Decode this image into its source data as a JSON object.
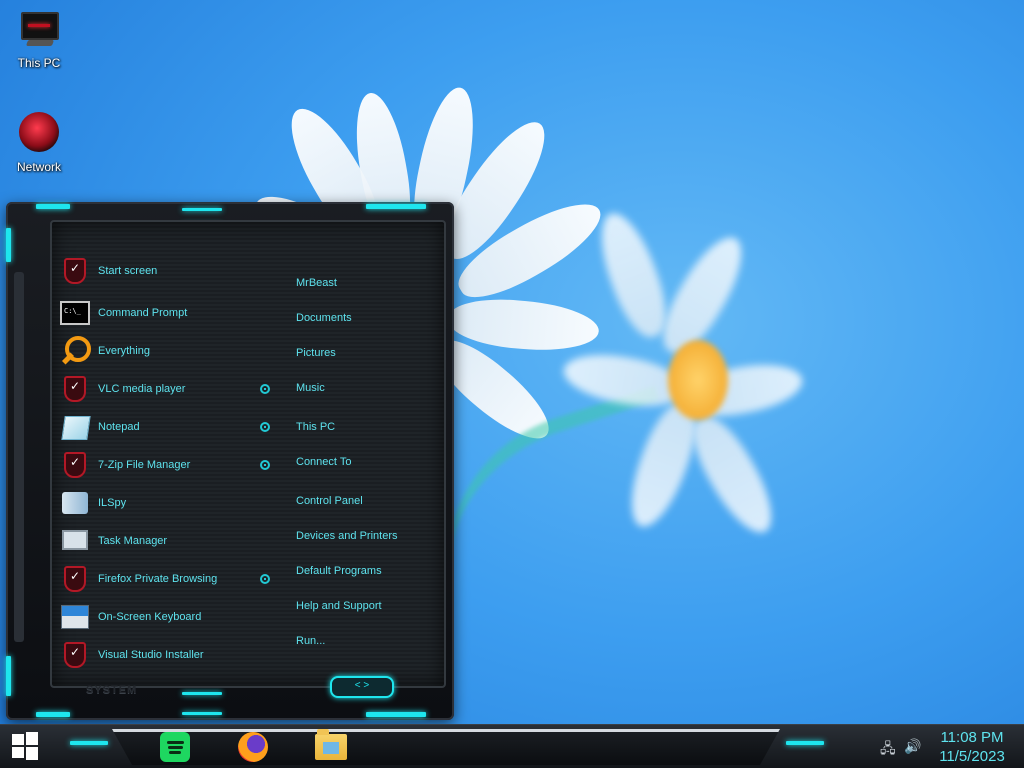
{
  "desktop": {
    "icons": [
      {
        "label": "This PC",
        "icon": "monitor-icon"
      },
      {
        "label": "Network",
        "icon": "network-orb-icon"
      }
    ]
  },
  "start_menu": {
    "programs": [
      {
        "label": "Start screen",
        "icon": "shield-app-icon"
      },
      {
        "label": "Command Prompt",
        "icon": "command-prompt-icon"
      },
      {
        "label": "Everything",
        "icon": "magnifier-icon"
      },
      {
        "label": "VLC media player",
        "icon": "shield-app-icon"
      },
      {
        "label": "Notepad",
        "icon": "notepad-icon"
      },
      {
        "label": "7-Zip File Manager",
        "icon": "shield-app-icon"
      },
      {
        "label": "ILSpy",
        "icon": "ilspy-icon"
      },
      {
        "label": "Task Manager",
        "icon": "task-manager-icon"
      },
      {
        "label": "Firefox Private Browsing",
        "icon": "shield-app-icon"
      },
      {
        "label": "On-Screen Keyboard",
        "icon": "keyboard-icon"
      },
      {
        "label": "Visual Studio Installer",
        "icon": "shield-app-icon"
      }
    ],
    "places": [
      {
        "label": "MrBeast"
      },
      {
        "label": "Documents"
      },
      {
        "label": "Pictures"
      },
      {
        "label": "Music"
      },
      {
        "label": "This PC"
      },
      {
        "label": "Connect To"
      },
      {
        "label": "Control Panel"
      },
      {
        "label": "Devices and Printers"
      },
      {
        "label": "Default Programs"
      },
      {
        "label": "Help and Support"
      },
      {
        "label": "Run..."
      }
    ],
    "system_label": "SYSTEM",
    "power_glyph": "< >"
  },
  "taskbar": {
    "pinned": [
      {
        "name": "Spotify",
        "icon": "spotify-icon"
      },
      {
        "name": "Firefox",
        "icon": "firefox-icon"
      },
      {
        "name": "File Explorer",
        "icon": "folder-icon"
      }
    ],
    "tray": [
      "network-icon",
      "volume-icon"
    ],
    "clock": {
      "time": "11:08 PM",
      "date": "11/5/2023"
    }
  },
  "colors": {
    "accent": "#5ee3ee",
    "led": "#1ee6ee",
    "wallpaper": "#3d9ef0"
  }
}
